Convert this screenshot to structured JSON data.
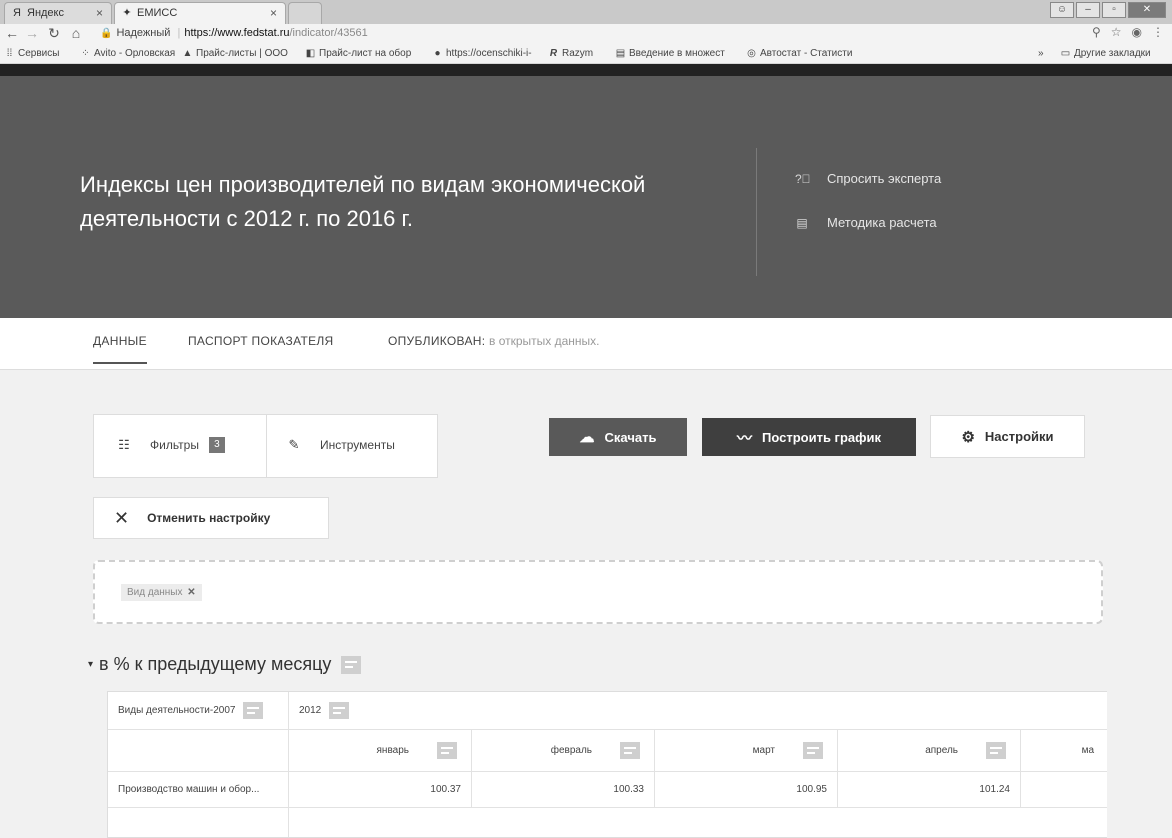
{
  "browser": {
    "tabs": [
      {
        "title": "Яндекс",
        "favicon": "Я"
      },
      {
        "title": "ЕМИСС",
        "favicon": "eagle-icon"
      }
    ],
    "address": {
      "secure_label": "Надежный",
      "host": "https://www.fedstat.ru",
      "path": "/indicator/43561"
    },
    "bookmarks": [
      "Сервисы",
      "Avito - Орловская",
      "Прайс-листы | ООО",
      "Прайс-лист на обор",
      "https://ocenschiki-i-",
      "Razym",
      "Введение в множест",
      "Автостат - Статисти",
      "»",
      "Другие закладки"
    ]
  },
  "header": {
    "title": "Индексы цен производителей по видам экономической деятельности с 2012 г. по 2016 г.",
    "links": [
      "Спросить эксперта",
      "Методика расчета"
    ]
  },
  "subnav": {
    "data_tab": "ДАННЫЕ",
    "passport_tab": "ПАСПОРТ ПОКАЗАТЕЛЯ",
    "published_label": "ОПУБЛИКОВАН:",
    "published_value": "в открытых данных."
  },
  "toolbar": {
    "filters_label": "Фильтры",
    "filters_count": "3",
    "tools_label": "Инструменты",
    "download_label": "Скачать",
    "chart_label": "Построить график",
    "settings_label": "Настройки",
    "cancel_label": "Отменить настройку"
  },
  "dropzone": {
    "chip": "Вид данных"
  },
  "section": {
    "title": "в % к предыдущему месяцу"
  },
  "table": {
    "row_dim_header": "Виды деятельности-2007",
    "year": "2012",
    "months": [
      "январь",
      "февраль",
      "март",
      "апрель",
      "ма"
    ],
    "rows": [
      {
        "label": "Производство машин и обор...",
        "values": [
          "100.37",
          "100.33",
          "100.95",
          "101.24",
          ""
        ]
      }
    ]
  }
}
